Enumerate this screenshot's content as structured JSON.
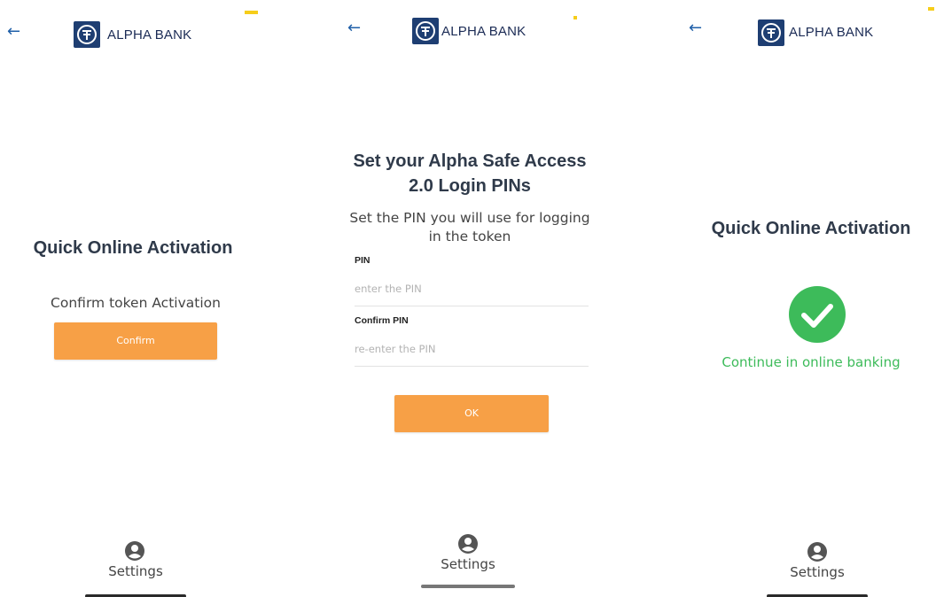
{
  "brand_name": "ALPHA BANK",
  "settings_label": "Settings",
  "colors": {
    "accent": "#f7a046",
    "brand_blue": "#1e3e72",
    "success": "#3dbb5a",
    "link_blue": "#1f5fa8"
  },
  "icons": {
    "back": "arrow-left-icon",
    "settings": "user-circle-icon",
    "success": "check-circle-icon"
  },
  "screen1": {
    "title": "Quick Online Activation",
    "subtitle": "Confirm token Activation",
    "confirm_label": "Confirm"
  },
  "screen2": {
    "title_line1": "Set your Alpha Safe Access",
    "title_line2": "2.0 Login PINs",
    "subtitle_line1": "Set the PIN you will use for logging",
    "subtitle_line2": "in the token",
    "pin_label": "PIN",
    "pin_placeholder": "enter the PIN",
    "confirm_pin_label": "Confirm PIN",
    "confirm_pin_placeholder": "re-enter the PIN",
    "ok_label": "OK"
  },
  "screen3": {
    "title": "Quick Online Activation",
    "success_message": "Continue in online banking"
  }
}
